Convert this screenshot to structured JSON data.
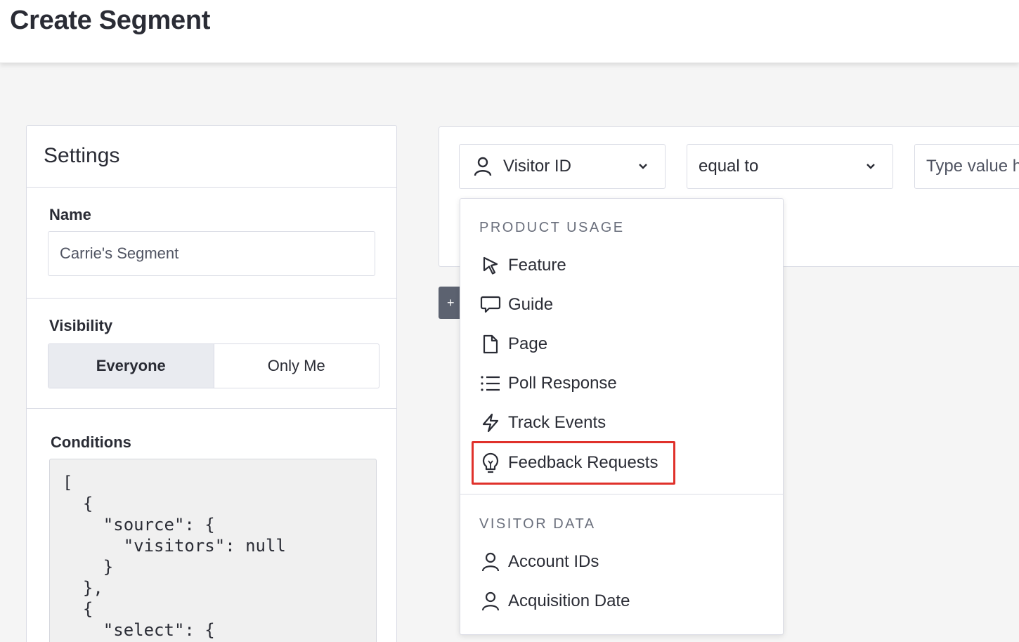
{
  "header": {
    "title": "Create Segment"
  },
  "settings": {
    "title": "Settings",
    "name_label": "Name",
    "name_value": "Carrie's Segment",
    "visibility_label": "Visibility",
    "visibility_options": [
      "Everyone",
      "Only Me"
    ],
    "visibility_selected": "Everyone",
    "conditions_label": "Conditions",
    "conditions_code": "[\n  {\n    \"source\": {\n      \"visitors\": null\n    }\n  },\n  {\n    \"select\": {"
  },
  "rule": {
    "field_value": "Visitor ID",
    "operator_value": "equal to",
    "value_placeholder": "Type value h",
    "add_label": "+"
  },
  "dropdown": {
    "group1_title": "PRODUCT USAGE",
    "group1_items": [
      {
        "label": "Feature",
        "icon": "cursor-icon"
      },
      {
        "label": "Guide",
        "icon": "speech-bubble-icon"
      },
      {
        "label": "Page",
        "icon": "document-icon"
      },
      {
        "label": "Poll Response",
        "icon": "list-icon"
      },
      {
        "label": "Track Events",
        "icon": "lightning-icon"
      },
      {
        "label": "Feedback Requests",
        "icon": "lightbulb-icon",
        "highlighted": true
      }
    ],
    "group2_title": "VISITOR DATA",
    "group2_items": [
      {
        "label": "Account IDs",
        "icon": "person-icon"
      },
      {
        "label": "Acquisition Date",
        "icon": "person-icon"
      }
    ]
  },
  "colors": {
    "highlight": "#e0312b",
    "border": "#dadce5",
    "text": "#2a2c35"
  }
}
